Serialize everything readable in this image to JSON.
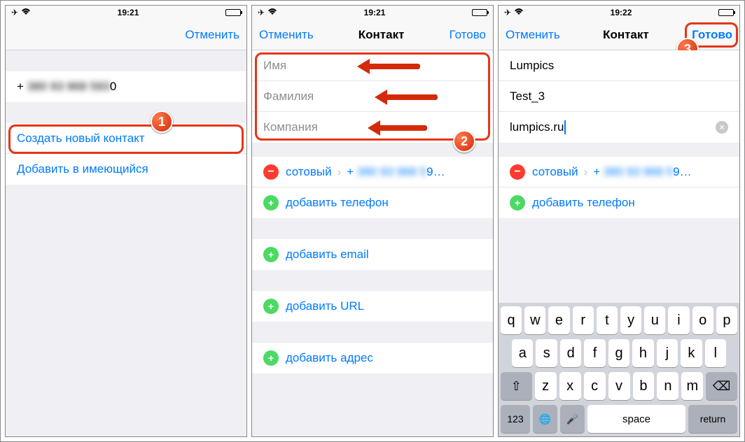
{
  "status": {
    "time1": "19:21",
    "time2": "19:21",
    "time3": "19:22"
  },
  "nav": {
    "cancel": "Отменить",
    "title": "Контакт",
    "done": "Готово"
  },
  "s1": {
    "phone": "+ 380 93 968 5930",
    "create": "Создать новый контакт",
    "addto": "Добавить в имеющийся"
  },
  "s2": {
    "name_ph": "Имя",
    "surname_ph": "Фамилия",
    "company_ph": "Компания",
    "mobile": "сотовый",
    "number": "+ 380 93 968 59…",
    "addphone": "добавить телефон",
    "addemail": "добавить email",
    "addurl": "добавить URL",
    "addaddr": "добавить адрес"
  },
  "s3": {
    "name": "Lumpics",
    "surname": "Test_3",
    "company": "lumpics.ru",
    "mobile": "сотовый",
    "number": "+ 380 93 968 59…",
    "addphone": "добавить телефон"
  },
  "kb": {
    "r1": [
      "q",
      "w",
      "e",
      "r",
      "t",
      "y",
      "u",
      "i",
      "o",
      "p"
    ],
    "r2": [
      "a",
      "s",
      "d",
      "f",
      "g",
      "h",
      "j",
      "k",
      "l"
    ],
    "r3": [
      "z",
      "x",
      "c",
      "v",
      "b",
      "n",
      "m"
    ],
    "shift": "⇧",
    "back": "⌫",
    "n123": "123",
    "globe": "🌐",
    "mic": "🎤",
    "space": "space",
    "return": "return"
  },
  "badges": {
    "b1": "1",
    "b2": "2",
    "b3": "3"
  }
}
